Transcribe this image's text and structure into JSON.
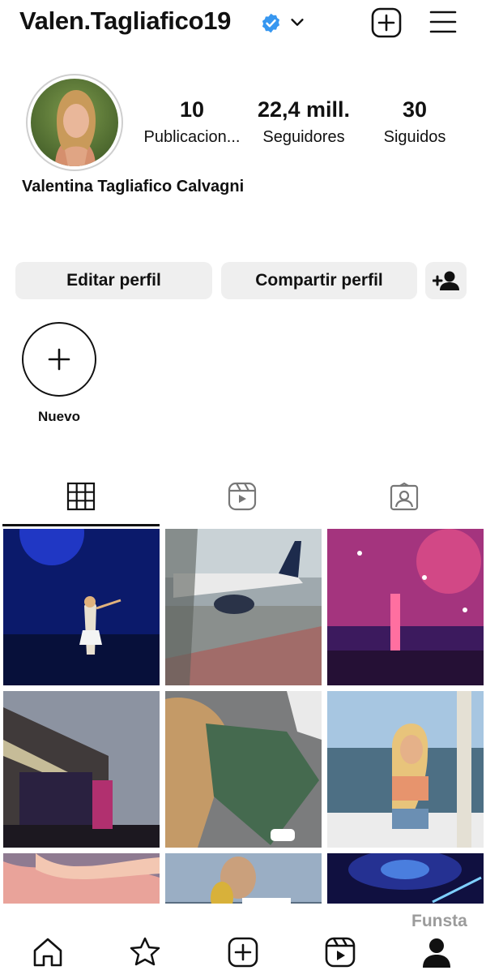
{
  "header": {
    "username": "Valen.Tagliafico19",
    "icons": [
      "verified-badge-icon",
      "chevron-down-icon",
      "new-post-icon",
      "menu-icon"
    ]
  },
  "profile": {
    "stats": [
      {
        "number": "10",
        "label": "Publicacion..."
      },
      {
        "number": "22,4 mill.",
        "label": "Seguidores"
      },
      {
        "number": "30",
        "label": "Siguidos"
      }
    ],
    "full_name": "Valentina Tagliafico Calvagni"
  },
  "actions": {
    "edit_label": "Editar perfil",
    "share_label": "Compartir perfil"
  },
  "highlights": {
    "new_label": "Nuevo"
  },
  "tabs": [
    "grid-icon",
    "reels-icon",
    "tagged-icon"
  ],
  "grid": {
    "photos": [
      "concert-blue-stage",
      "airplane-tarmac",
      "confetti-stadium",
      "festival-stage-sunset",
      "denim-shorts-closeup",
      "boat-lake-selfie",
      "pink-sunset-sky",
      "trophy-celebration",
      "stadium-blue-lights"
    ]
  },
  "watermark": "Funsta",
  "bottom_nav": [
    "home-icon",
    "favorites-icon",
    "create-icon",
    "reels-icon",
    "profile-icon"
  ],
  "colors": {
    "verified": "#3797f0",
    "button_bg": "#efefef",
    "text": "#111111"
  }
}
